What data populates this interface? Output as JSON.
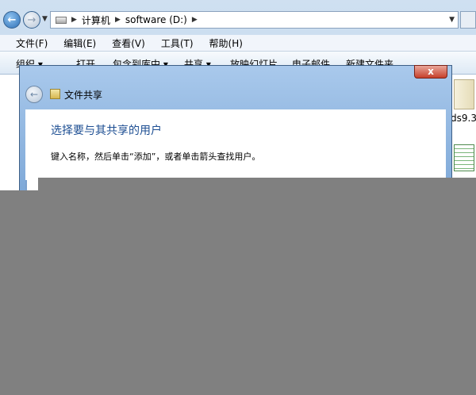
{
  "explorer": {
    "breadcrumb": [
      "计算机",
      "software (D:)"
    ],
    "menu": [
      "文件(F)",
      "编辑(E)",
      "查看(V)",
      "工具(T)",
      "帮助(H)"
    ],
    "toolbar": [
      "组织 ▾",
      "打开",
      "包含到库中 ▾",
      "共享 ▾",
      "放映幻灯片",
      "电子邮件",
      "新建文件夹"
    ],
    "side_label": "ds9.3"
  },
  "dialog": {
    "title": "文件共享",
    "heading": "选择要与其共享的用户",
    "instruction": "键入名称，然后单击“添加”，或者单击箭头查找用户。",
    "close": "x"
  }
}
